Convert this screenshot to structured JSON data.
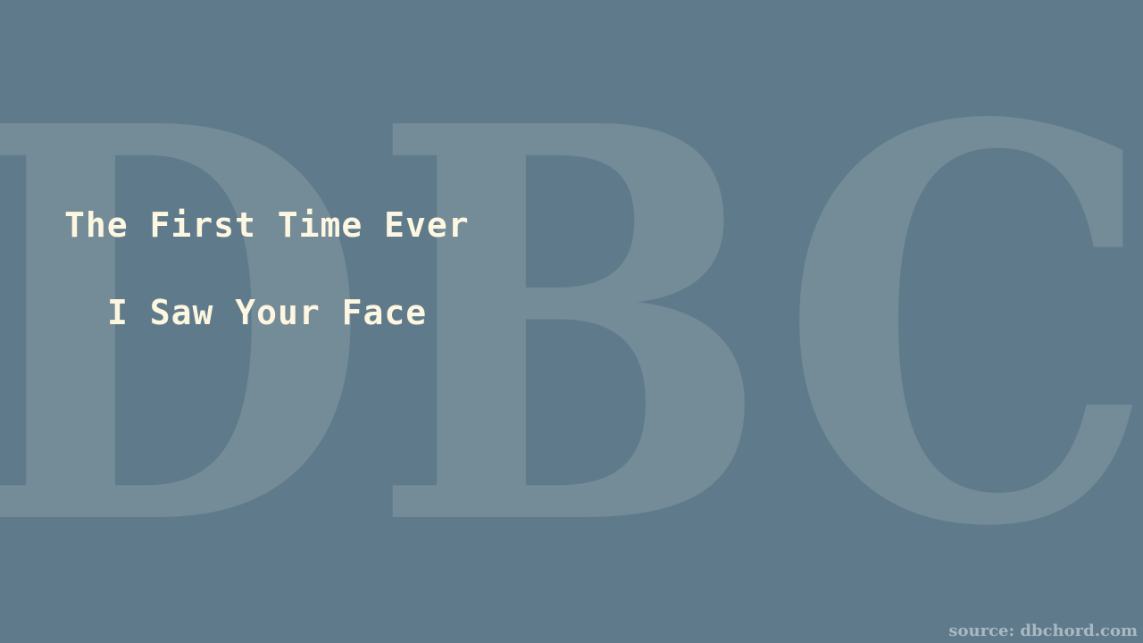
{
  "colors": {
    "background": "#5f7b8b",
    "watermark": "#748b98",
    "title_text": "#fdf6e0",
    "source_text": "#a9b9c3"
  },
  "watermark": {
    "text": "DBC"
  },
  "title": {
    "line1": "The First Time Ever",
    "line2": "I Saw Your Face"
  },
  "footer": {
    "source": "source: dbchord.com"
  }
}
